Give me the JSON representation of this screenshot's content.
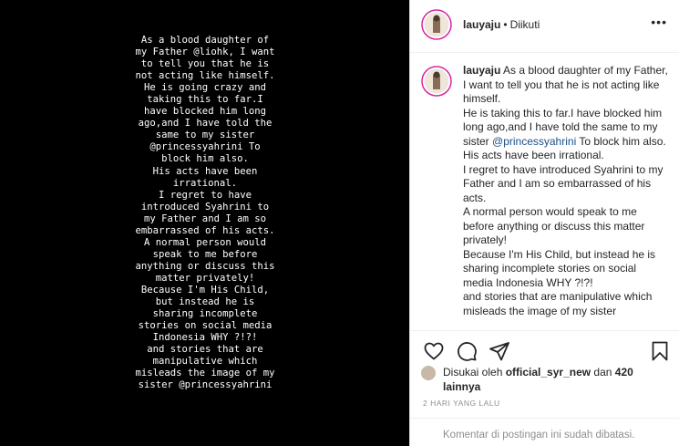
{
  "story": {
    "lines": [
      "As a blood daughter of",
      "my Father @liohk, I want",
      "to tell you that he is",
      "not acting like himself.",
      "He is going crazy and",
      "taking this to far.I",
      "have blocked him long",
      "ago,and I have told the",
      "same to my sister",
      "@princessyahrini To",
      "block him also.",
      "His acts have been",
      "irrational.",
      "I regret to have",
      "introduced Syahrini to",
      "my Father and I am so",
      "embarrassed of his acts.",
      "A normal person would",
      "speak to me before",
      "anything or discuss this",
      "matter privately!",
      "Because I'm His Child,",
      "but instead he is",
      "sharing incomplete",
      "stories on social media",
      "Indonesia WHY ?!?!",
      "and stories that are",
      "manipulative which",
      "misleads the image of my",
      "sister @princessyahrini"
    ]
  },
  "header": {
    "username": "lauyaju",
    "separator": "•",
    "follow_status": "Diikuti",
    "more_label": "•••"
  },
  "caption": {
    "username": "lauyaju",
    "p1": "As a blood daughter of my Father, I want to tell you that he is not acting like himself.",
    "p2_a": "He is taking this to far.I have blocked him long ago,and I have told the same to my sister ",
    "p2_mention": "@princessyahrini",
    "p2_b": " To block him also.",
    "p3": "His acts have been irrational.",
    "p4": "I regret to have introduced Syahrini to my Father and I am so embarrassed of his acts.",
    "p5": "A normal person would speak to me before anything or discuss this matter privately!",
    "p6": "Because I'm His Child, but instead he is sharing incomplete stories on social media Indonesia WHY ?!?!",
    "p7": "and stories that are manipulative which misleads the image of my sister"
  },
  "actions": {
    "like_icon": "heart-icon",
    "comment_icon": "comment-icon",
    "share_icon": "share-icon",
    "save_icon": "bookmark-icon"
  },
  "likes": {
    "prefix": "Disukai oleh ",
    "user": "official_syr_new",
    "middle": " dan ",
    "others": "420 lainnya"
  },
  "timestamp": "2 HARI YANG LALU",
  "footer": {
    "comments_disabled": "Komentar di postingan ini sudah dibatasi."
  }
}
